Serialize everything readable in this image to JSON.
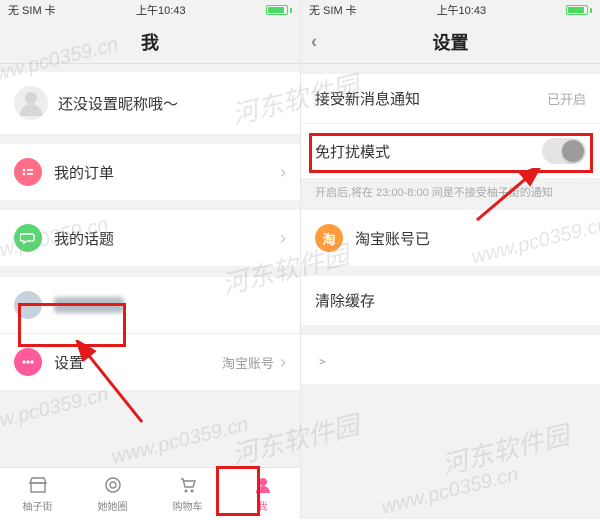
{
  "statusbar": {
    "carrier": "无 SIM 卡",
    "time": "上午10:43"
  },
  "left": {
    "title": "我",
    "profile_text": "还没设置昵称哦～",
    "rows": {
      "orders": "我的订单",
      "topics": "我的话题",
      "settings": "设置",
      "settings_right": "淘宝账号"
    },
    "tabs": {
      "t1": "柚子街",
      "t2": "她她圈",
      "t3": "购物车",
      "t4": "我"
    }
  },
  "right": {
    "title": "设置",
    "notify_label": "接受新消息通知",
    "notify_status": "已开启",
    "dnd_label": "免打扰模式",
    "dnd_hint": "开启后,将在 23:00-8:00 间是不接受柚子街的通知",
    "taobao_label": "淘宝账号已",
    "clear_cache": "清除缓存"
  },
  "watermark": {
    "url": "www.pc0359.cn",
    "brand": "河东软件园"
  }
}
